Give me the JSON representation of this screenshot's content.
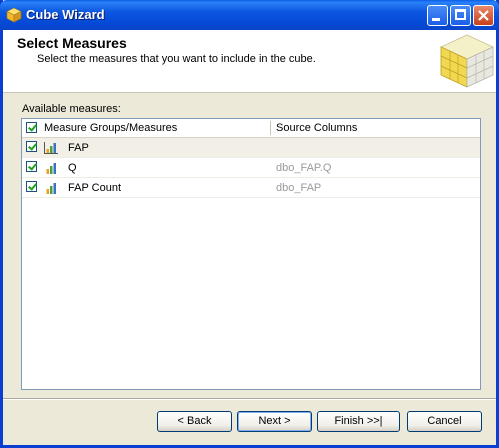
{
  "window": {
    "title": "Cube Wizard"
  },
  "header": {
    "title": "Select Measures",
    "subtitle": "Select the measures that you want to include in the cube."
  },
  "available_label": "Available measures:",
  "columns": [
    "Measure Groups/Measures",
    "Source Columns"
  ],
  "rows": [
    {
      "name": "FAP",
      "source": "",
      "checked": true
    },
    {
      "name": "Q",
      "source": "dbo_FAP.Q",
      "checked": true
    },
    {
      "name": "FAP Count",
      "source": "dbo_FAP",
      "checked": true
    }
  ],
  "buttons": {
    "back": "< Back",
    "next": "Next >",
    "finish": "Finish >>|",
    "cancel": "Cancel"
  },
  "colors": {
    "title_bar": "#0c56e0",
    "check": "#21a121",
    "source_text": "#9a9a9a"
  }
}
